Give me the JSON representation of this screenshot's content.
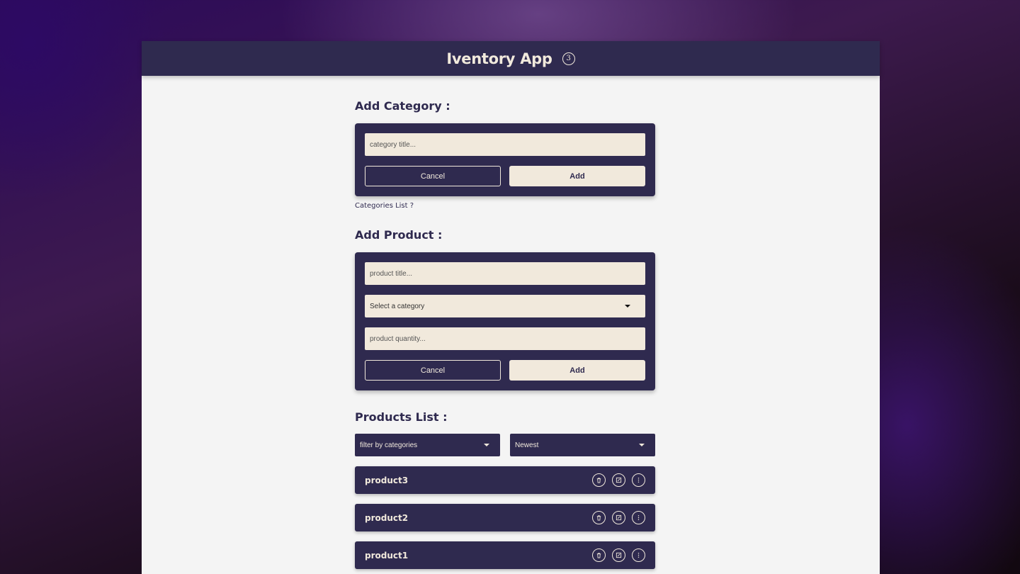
{
  "header": {
    "title": "Iventory App",
    "count": "3"
  },
  "add_category": {
    "title": "Add Category :",
    "title_placeholder": "category title...",
    "cancel_label": "Cancel",
    "add_label": "Add",
    "list_link": "Categories List ?"
  },
  "add_product": {
    "title": "Add Product :",
    "title_placeholder": "product title...",
    "category_select": "Select a category",
    "quantity_placeholder": "product quantity...",
    "cancel_label": "Cancel",
    "add_label": "Add"
  },
  "products_list": {
    "title": "Products List :",
    "filter_label": "filter by categories",
    "sort_label": "Newest",
    "items": [
      {
        "name": "product3"
      },
      {
        "name": "product2"
      },
      {
        "name": "product1"
      }
    ]
  },
  "icons": [
    "trash-icon",
    "edit-icon",
    "more-icon"
  ],
  "colors": {
    "primary": "#2f2a4f",
    "cream": "#f1e9dc",
    "background": "#f4f4f4"
  }
}
